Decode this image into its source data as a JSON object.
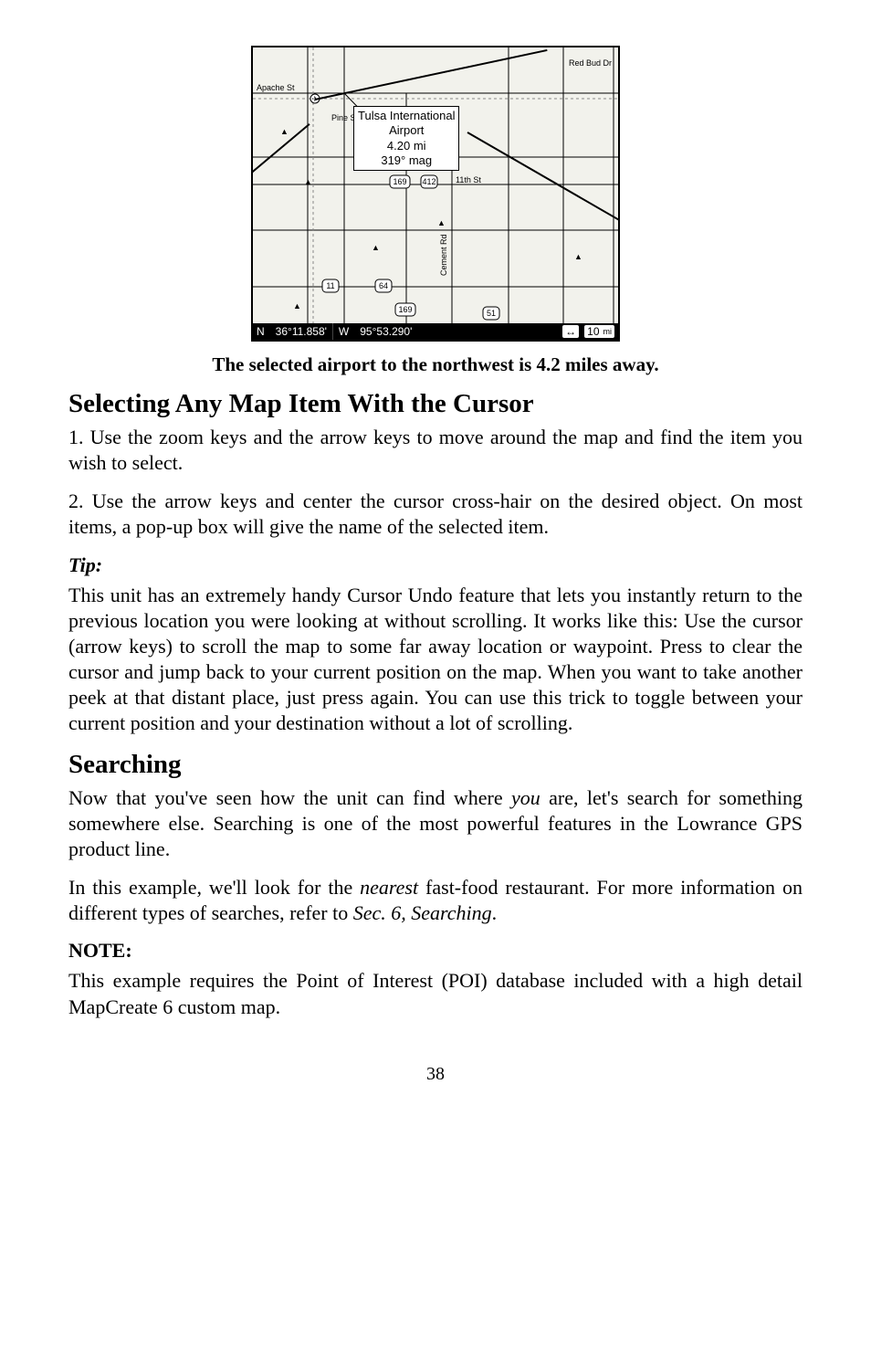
{
  "figure": {
    "popup_line1": "Tulsa International",
    "popup_line2": "Airport",
    "popup_line3": "4.20 mi",
    "popup_line4": "319° mag",
    "roads": {
      "apache": "Apache St",
      "eleventh": "11th St",
      "cement": "Cement Rd",
      "redbud": "Red Bud Dr",
      "pine": "Pine St"
    },
    "shields": {
      "r169a": "169",
      "r169b": "169",
      "r64": "64",
      "r11": "11",
      "r51": "51",
      "r412_244": "412"
    },
    "status": {
      "n_label": "N",
      "lat": "36°11.858'",
      "w_label": "W",
      "lon": "95°53.290'",
      "scale": "10",
      "scale_unit": "mi",
      "arrow": "↔"
    }
  },
  "caption": "The selected airport to the northwest is 4.2 miles away.",
  "h2_a": "Selecting Any Map Item With the Cursor",
  "para1": "1. Use the zoom keys and the arrow keys to move around the map and find the item you wish to select.",
  "para2": "2. Use the arrow keys and center the cursor cross-hair on the desired object. On most items, a pop-up box will give the name of the selected item.",
  "tip_label": "Tip:",
  "tip_body_a": "This unit has an extremely handy Cursor Undo feature that lets you instantly return to the previous location you were looking at without scrolling. It works like this: Use the cursor (arrow keys) to scroll the map to some far away location or waypoint. Press ",
  "tip_body_b": " to clear the cursor and jump back to your current position on the map. When you want to take another peek at that distant place, just press ",
  "tip_body_c": " again. You can use this trick to toggle between your current position and your destination without a lot of scrolling.",
  "h2_b": "Searching",
  "para3a": "Now that you've seen how the unit can find where ",
  "para3_em": "you",
  "para3b": " are, let's search for something somewhere else. Searching is one of the most powerful features in the Lowrance GPS product line.",
  "para4a": "In this example, we'll look for the ",
  "para4_em1": "nearest",
  "para4b": " fast-food restaurant. For more information on different types of searches, refer to ",
  "para4_em2": "Sec. 6, Searching",
  "para4c": ".",
  "note_label": "NOTE:",
  "note_body": "This example requires the Point of Interest (POI) database included with a high detail MapCreate 6 custom map.",
  "page_number": "38"
}
